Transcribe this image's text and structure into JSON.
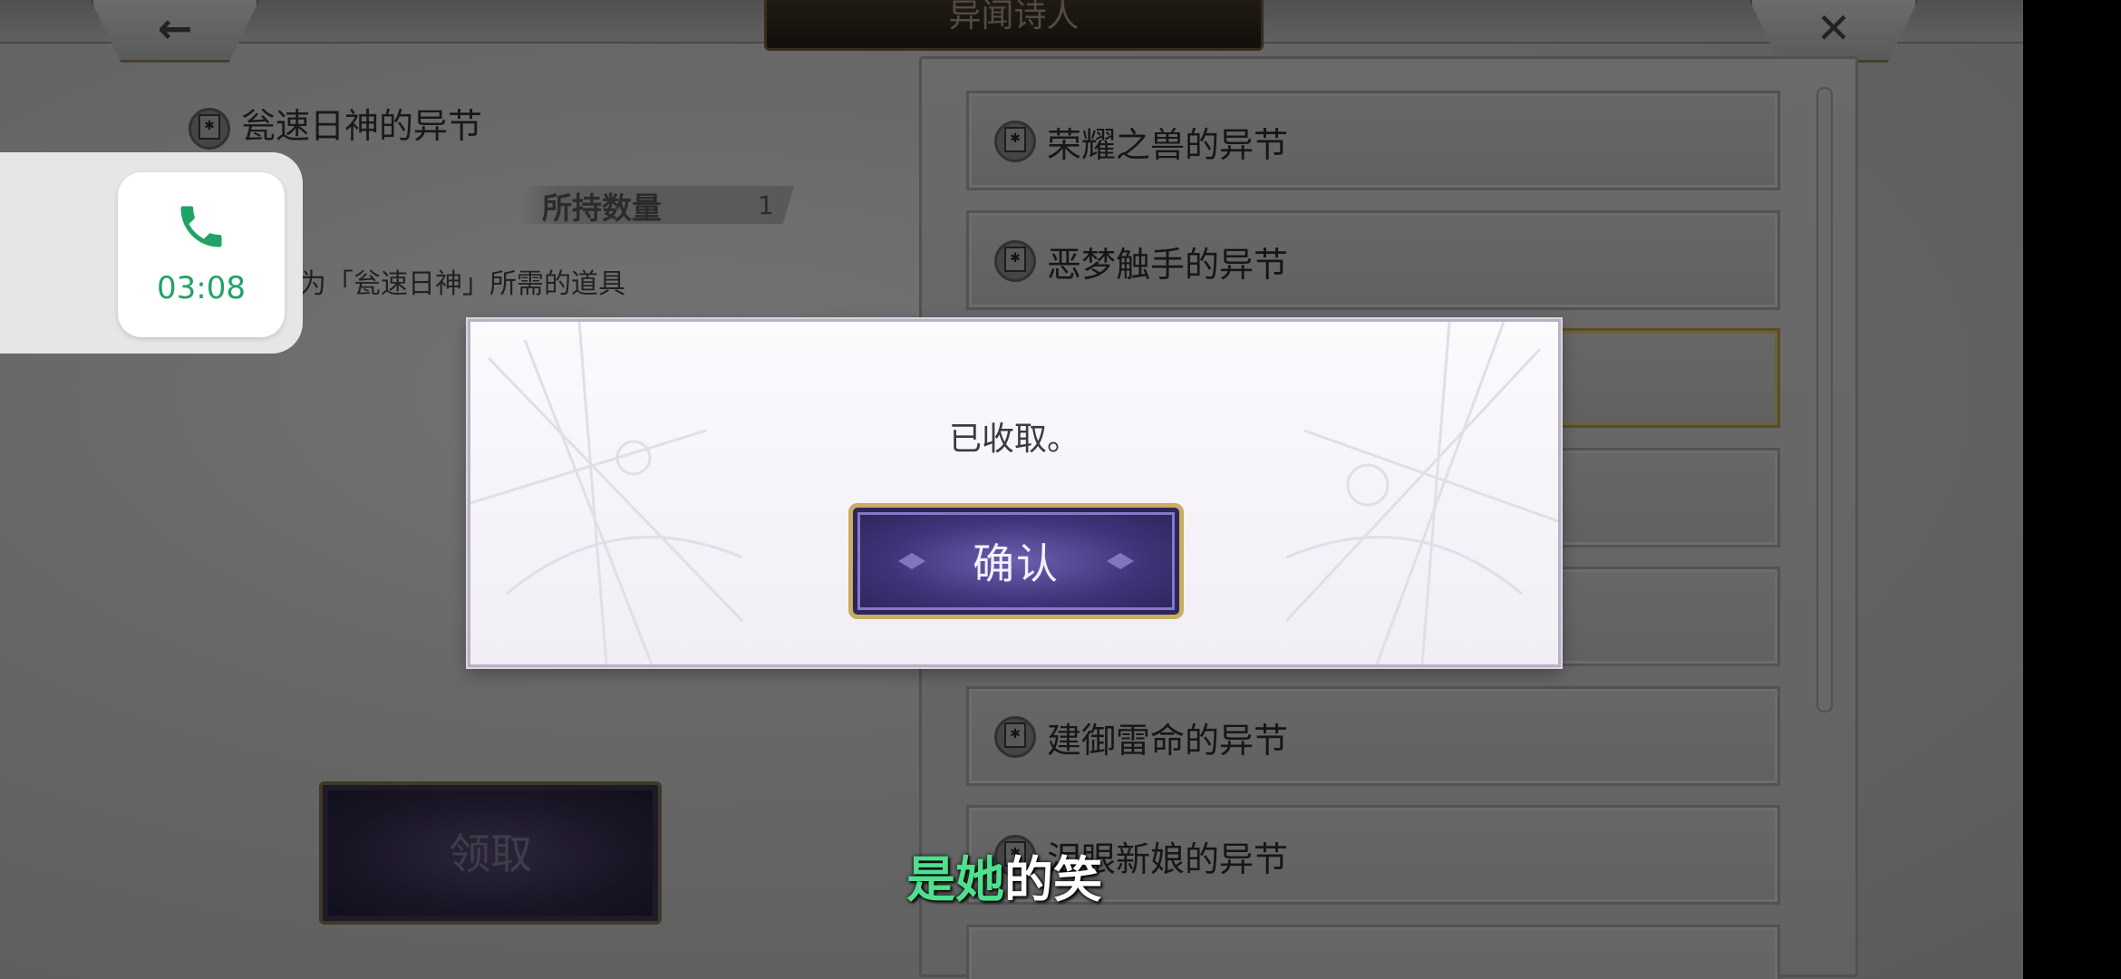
{
  "header": {
    "title": "异闻诗人",
    "back_glyph": "←",
    "close_glyph": "✕"
  },
  "detail": {
    "item_name": "瓮速日神的异节",
    "quantity_label": "所持数量",
    "quantity_value": "1",
    "description": "为「瓮速日神」所需的道具",
    "claim_label": "领取"
  },
  "list": {
    "items": [
      {
        "label": "荣耀之兽的异节"
      },
      {
        "label": "恶梦触手的异节"
      },
      {
        "label": ""
      },
      {
        "label": ""
      },
      {
        "label": ""
      },
      {
        "label": "建御雷命的异节"
      },
      {
        "label": "泪眼新娘的异节"
      }
    ],
    "selected_index": 2
  },
  "dialog": {
    "message": "已收取。",
    "confirm_label": "确认"
  },
  "call_widget": {
    "time": "03:08",
    "icon": "phone-icon",
    "color": "#21a366"
  },
  "subtitle": {
    "highlighted": "是她",
    "rest": "的笑",
    "highlight_color": "#4fe08e"
  }
}
